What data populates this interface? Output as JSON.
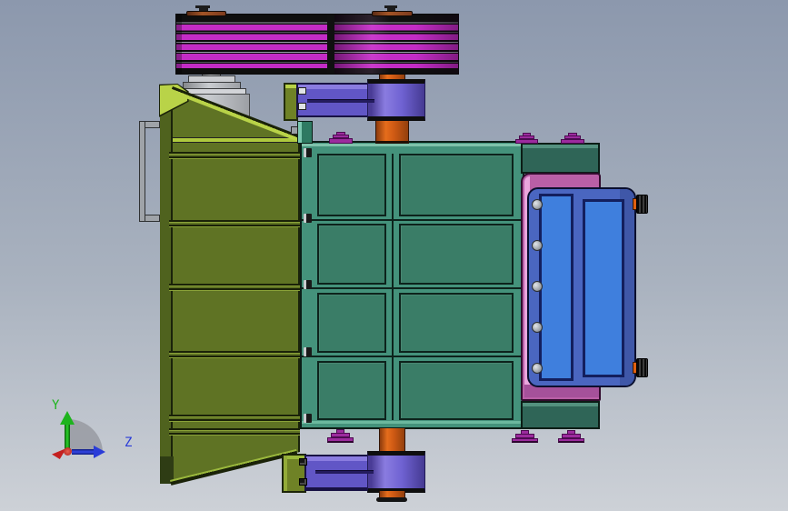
{
  "app": {
    "name": "cad-3d-viewport",
    "view": "side-view-assembly"
  },
  "triad": {
    "y_label": "Y",
    "z_label": "Z"
  },
  "colors": {
    "bg-top": "#8c98ad",
    "bg-mid": "#a9b2bf",
    "bg-bottom": "#cdd1d7",
    "pulley": "#c32cc6",
    "pulley-dark": "#7d1886",
    "orange": "#cf5a14",
    "orange-hi": "#e56d1c",
    "orange-dark": "#8c3a0c",
    "purple": "#6156c6",
    "purple-hi": "#8a7ce0",
    "purple-dark": "#453a92",
    "teal-frame": "#44927b",
    "teal-panel": "#3a7d67",
    "teal-dark": "#2f6557",
    "teal-edge": "#7fc3ab",
    "olive": "#5f7324",
    "olive-dark": "#4f621e",
    "olive-deep": "#2e3c14",
    "green-hi": "#b9d348",
    "green-mid": "#9ab83c",
    "pink": "#b95fa6",
    "pink-hi": "#eba6dd",
    "pink-dark": "#a5519a",
    "blue-plate": "#4a66c0",
    "blue-plate-dark": "#3f57a8",
    "blue-panel": "#3f7fdd",
    "navy": "#131f5e",
    "metal": "#c9ccd0",
    "metal-dark": "#85888c",
    "magenta-fit": "#9c2b9e",
    "axis-green": "#1db41d",
    "axis-blue": "#2a3cd8",
    "axis-red": "#c42020",
    "brown": "#7e3c1e"
  },
  "components": {
    "belt_drive": "v-belt pulley pair",
    "motor": "gray motor / support stack",
    "drive_shaft": "vertical orange shaft",
    "bearings": "purple pillow-block bearings (top, bottom)",
    "screen_frame": "teal panel frame 2x4",
    "hopper": "olive feed hopper (left)",
    "side_door": "blue inspection doors on pink mounting plate",
    "fittings": "magenta flanges and feet"
  }
}
